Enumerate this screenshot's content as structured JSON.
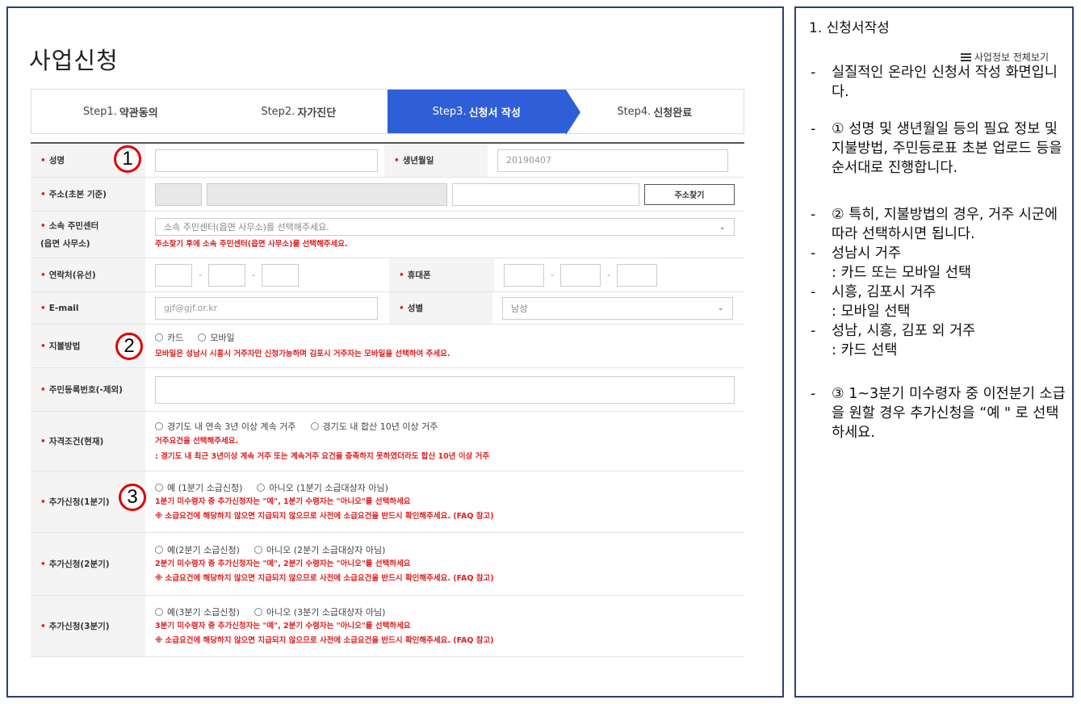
{
  "page": {
    "title": "사업신청",
    "view_all": "사업정보 전체보기"
  },
  "steps": [
    {
      "prefix": "Step1.",
      "name": "약관동의"
    },
    {
      "prefix": "Step2.",
      "name": "자가진단"
    },
    {
      "prefix": "Step3.",
      "name": "신청서 작성"
    },
    {
      "prefix": "Step4.",
      "name": "신청완료"
    }
  ],
  "form": {
    "name_label": "성명",
    "birth_label": "생년월일",
    "birth_value": "20190407",
    "address_label": "주소(초본 기준)",
    "address_button": "주소찾기",
    "center_label_1": "소속 주민센터",
    "center_label_2": "(읍면 사무소)",
    "center_placeholder": "소속 주민센터(읍면 사무소)를 선택해주세요.",
    "center_note": "주소찾기 후에 소속 주민센터(읍면 사무소)를 선택해주세요.",
    "phone_label": "연락처(유선)",
    "mobile_label": "휴대폰",
    "email_label": "E-mail",
    "email_placeholder": "gjf@gjf.or.kr",
    "gender_label": "성별",
    "gender_value": "남성",
    "payment_label": "지불방법",
    "payment_options": [
      "카드",
      "모바일"
    ],
    "payment_note": "모바일은 성남시 시흥시 거주자만 신청가능하며 김포시 거주자는 모바일을 선택하여 주세요.",
    "rrn_label": "주민등록번호(-제외)",
    "qual_label": "자격조건(현재)",
    "qual_options": [
      "경기도 내 연속 3년 이상 계속 거주",
      "경기도 내 합산 10년 이상 거주"
    ],
    "qual_note_1": "거주요건을 선택해주세요.",
    "qual_note_2": ": 경기도 내 최근 3년이상 계속 거주 또는 계속거주 요건을 충족하지 못하였더라도 합산 10년 이상 거주",
    "extra": [
      {
        "label": "추가신청(1분기)",
        "yes": "예 (1분기 소급신청)",
        "no": "아니오 (1분기 소급대상자 아님)",
        "note1": "1분기 미수령자 중 추가신청자는 \"예\", 1분기 수령자는 \"아니오\"를 선택하세요",
        "note2": "※ 소급요건에 해당하지 않으면 지급되지 않으므로 사전에 소급요건을 반드시 확인해주세요. (FAQ 참고)"
      },
      {
        "label": "추가신청(2분기)",
        "yes": "예(2분기 소급신청)",
        "no": "아니오 (2분기 소급대상자 아님)",
        "note1": "2분기 미수령자 중 추가신청자는 \"예\", 2분기 수령자는 \"아니오\"를 선택하세요",
        "note2": "※ 소급요건에 해당하지 않으면 지급되지 않으므로 사전에 소급요건을 반드시 확인해주세요. (FAQ 참고)"
      },
      {
        "label": "추가신청(3분기)",
        "yes": "예(3분기 소급신청)",
        "no": "아니오 (3분기 소급대상자 아님)",
        "note1": "3분기 미수령자 중 추가신청자는 \"예\", 2분기 수령자는 \"아니오\"를 선택하세요",
        "note2": "※ 소급요건에 해당하지 않으면 지급되지 않으므로 사전에 소급요건을 반드시 확인해주세요. (FAQ 참고)"
      }
    ]
  },
  "markers": [
    "1",
    "2",
    "3"
  ],
  "guide": {
    "title": "1.  신청서작성",
    "items": [
      {
        "mark": "-",
        "text": "실질적인 온라인 신청서 작성 화면입니다."
      },
      {
        "mark": "-",
        "text": "① 성명 및 생년월일 등의 필요 정보 및 지불방법, 주민등로표 초본 업로드 등을 순서대로 진행합니다."
      },
      {
        "mark": "-",
        "text": "② 특히, 지불방법의 경우, 거주 시군에 따라 선택하시면 됩니다."
      },
      {
        "mark": "-",
        "text": "성남시 거주"
      },
      {
        "mark": "",
        "text": ": 카드 또는 모바일 선택"
      },
      {
        "mark": "-",
        "text": "시흥, 김포시 거주"
      },
      {
        "mark": "",
        "text": ": 모바일 선택"
      },
      {
        "mark": "-",
        "text": "성남, 시흥, 김포 외 거주"
      },
      {
        "mark": "",
        "text": ": 카드 선택"
      },
      {
        "mark": "-",
        "text": "③ 1~3분기 미수령자 중 이전분기 소급을 원할 경우 추가신청을 “예 \" 로 선택하세요."
      }
    ]
  }
}
